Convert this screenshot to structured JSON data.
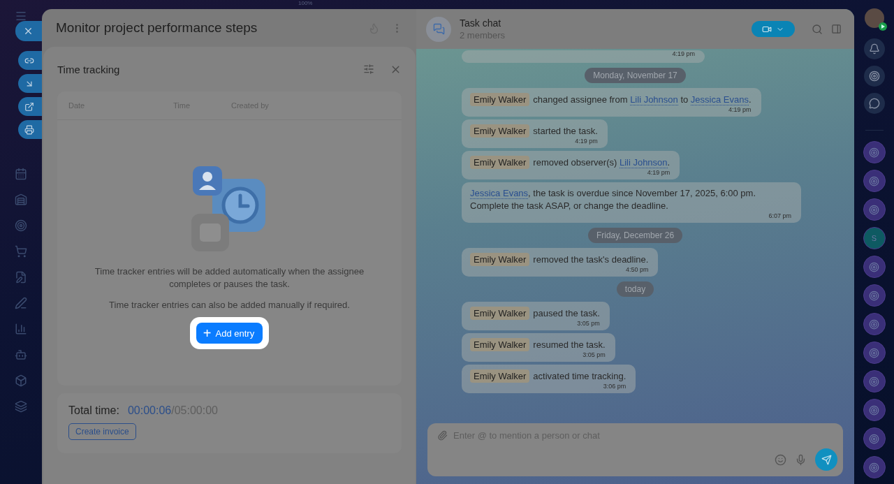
{
  "top_bar": {
    "zoom": "100%"
  },
  "task": {
    "title": "Monitor project performance steps"
  },
  "time_tracking": {
    "title": "Time tracking",
    "columns": [
      "Date",
      "Time",
      "Created by"
    ],
    "empty_text": [
      "Time tracker entries will be added automatically when the assignee completes or pauses the task.",
      "Time tracker entries can also be added manually if required."
    ],
    "add_button": {
      "icon": "+",
      "label": "Add entry",
      "highlighted": true
    },
    "total_label": "Total time:",
    "total_spent": "00:00:06",
    "total_limit": "/05:00:00",
    "invoice_button": "Create invoice"
  },
  "chat": {
    "title": "Task chat",
    "subtitle": "2 members",
    "placeholder": "Enter @ to mention a person or chat",
    "messages": [
      {
        "kind": "tail",
        "time": "4:19 pm"
      },
      {
        "kind": "date",
        "text": "Monday, November 17"
      },
      {
        "kind": "event",
        "author": "Emily Walker",
        "parts": [
          {
            "kind": "text",
            "text": "changed assignee from "
          },
          {
            "kind": "link",
            "text": "Lili Johnson"
          },
          {
            "kind": "text",
            "text": " to "
          },
          {
            "kind": "link",
            "text": "Jessica Evans"
          },
          {
            "kind": "text",
            "text": "."
          }
        ],
        "time": "4:19 pm"
      },
      {
        "kind": "event",
        "author": "Emily Walker",
        "parts": [
          {
            "kind": "text",
            "text": "started the task."
          }
        ],
        "time": "4:19 pm"
      },
      {
        "kind": "event",
        "author": "Emily Walker",
        "parts": [
          {
            "kind": "text",
            "text": "removed observer(s) "
          },
          {
            "kind": "link",
            "text": "Lili Johnson"
          },
          {
            "kind": "text",
            "text": "."
          }
        ],
        "time": "4:19 pm"
      },
      {
        "kind": "system",
        "parts": [
          {
            "kind": "link",
            "text": "Jessica Evans"
          },
          {
            "kind": "text",
            "text": ", the task is overdue since November 17, 2025, 6:00 pm. Complete the task ASAP, or change the deadline."
          }
        ],
        "time": "6:07 pm"
      },
      {
        "kind": "date",
        "text": "Friday, December 26"
      },
      {
        "kind": "event",
        "author": "Emily Walker",
        "parts": [
          {
            "kind": "text",
            "text": "removed the task's deadline."
          }
        ],
        "time": "4:50 pm"
      },
      {
        "kind": "date",
        "text": "today"
      },
      {
        "kind": "event",
        "author": "Emily Walker",
        "parts": [
          {
            "kind": "text",
            "text": "paused the task."
          }
        ],
        "time": "3:05 pm"
      },
      {
        "kind": "event",
        "author": "Emily Walker",
        "parts": [
          {
            "kind": "text",
            "text": "resumed the task."
          }
        ],
        "time": "3:05 pm"
      },
      {
        "kind": "event",
        "author": "Emily Walker",
        "parts": [
          {
            "kind": "text",
            "text": "activated time tracking."
          }
        ],
        "time": "3:06 pm"
      }
    ]
  },
  "right_rail": {
    "chats": [
      {
        "kind": "icon"
      },
      {
        "kind": "icon"
      },
      {
        "kind": "icon"
      },
      {
        "kind": "letter",
        "letter": "S"
      },
      {
        "kind": "icon"
      },
      {
        "kind": "icon"
      },
      {
        "kind": "icon"
      },
      {
        "kind": "icon"
      },
      {
        "kind": "icon"
      },
      {
        "kind": "icon"
      },
      {
        "kind": "icon"
      },
      {
        "kind": "icon"
      }
    ]
  }
}
